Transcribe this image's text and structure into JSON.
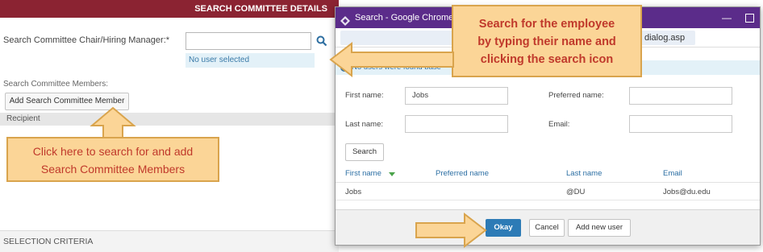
{
  "background_form": {
    "section_title": "SEARCH COMMITTEE DETAILS",
    "chair_label": "Search Committee Chair/Hiring Manager:*",
    "no_user_selected": "No user selected",
    "members_label": "Search Committee Members:",
    "add_member_button": "Add Search Committee Member",
    "recipient_header": "Recipient",
    "selection_criteria": "SELECTION CRITERIA"
  },
  "callouts": {
    "search_employee_line1": "Search for the employee",
    "search_employee_line2": "by typing their name and",
    "search_employee_line3": "clicking the search icon",
    "add_members_line1": "Click here to search for and add",
    "add_members_line2": "Search Committee Members"
  },
  "dialog": {
    "window_title": "Search - Google Chrome",
    "url_fragment": "dialog.asp",
    "info_text": "No users were found base",
    "first_name_label": "First name:",
    "first_name_value": "Jobs",
    "preferred_name_label": "Preferred name:",
    "last_name_label": "Last name:",
    "email_label": "Email:",
    "search_button": "Search",
    "table": {
      "headers": [
        "First name",
        "Preferred name",
        "Last name",
        "Email"
      ],
      "rows": [
        [
          "Jobs",
          "",
          "@DU",
          "Jobs@du.edu"
        ]
      ]
    },
    "okay_button": "Okay",
    "cancel_button": "Cancel",
    "add_new_user_button": "Add new user"
  },
  "colors": {
    "header_maroon": "#8b2332",
    "titlebar_purple": "#5b2c8a",
    "callout_fill": "#fbd597",
    "callout_text": "#c0392b",
    "okay_blue": "#2d7bb6"
  }
}
